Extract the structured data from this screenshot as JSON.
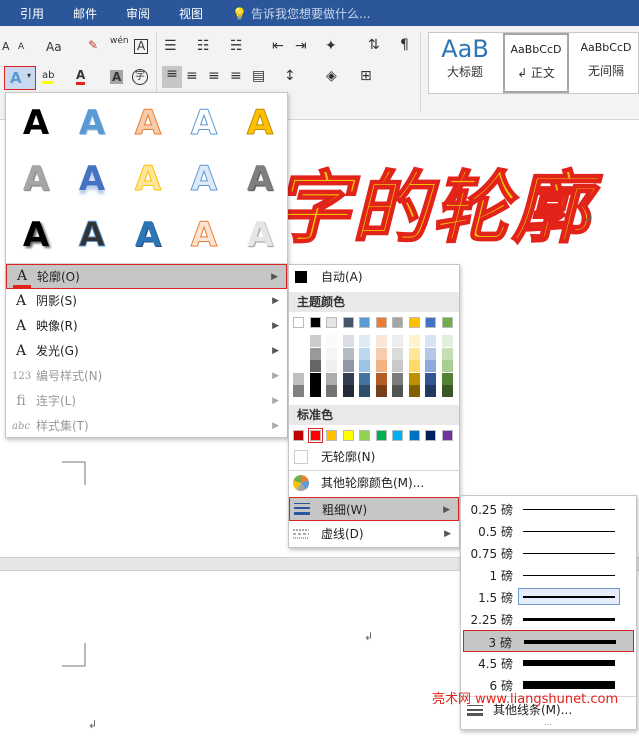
{
  "topbar": {
    "tabs": [
      "引用",
      "邮件",
      "审阅",
      "视图"
    ],
    "tell_me": "告诉我您想要做什么..."
  },
  "ribbon": {
    "font_size_up": "A",
    "font_size_down": "A",
    "change_case": "Aa",
    "phonetic_guide": "wén",
    "char_border": "A",
    "text_effects": "A",
    "highlight": "ab",
    "font_color": "A",
    "char_shading": "A",
    "enclose_char": "字",
    "styles": [
      {
        "sample": "AaB",
        "label": "大标题"
      },
      {
        "sample": "AaBbCcD",
        "label": "↲ 正文"
      },
      {
        "sample": "AaBbCcD",
        "label": "无间隔"
      }
    ]
  },
  "document": {
    "big_text": "字的轮廓",
    "pilcrow": "↲"
  },
  "fx_menu": {
    "letter": "A",
    "items": [
      {
        "icon": "A",
        "label": "轮廓(O)",
        "disabled": false
      },
      {
        "icon": "A",
        "label": "阴影(S)",
        "disabled": false
      },
      {
        "icon": "A",
        "label": "映像(R)",
        "disabled": false
      },
      {
        "icon": "A",
        "label": "发光(G)",
        "disabled": false
      },
      {
        "icon": "123",
        "label": "编号样式(N)",
        "disabled": true
      },
      {
        "icon": "fi",
        "label": "连字(L)",
        "disabled": true
      },
      {
        "icon": "abc",
        "label": "样式集(T)",
        "disabled": true
      }
    ]
  },
  "outline_menu": {
    "auto": "自动(A)",
    "theme_colors_header": "主题颜色",
    "standard_colors_header": "标准色",
    "no_outline": "无轮廓(N)",
    "more_colors": "其他轮廓颜色(M)...",
    "weight": "粗细(W)",
    "dashes": "虚线(D)",
    "theme_colors": [
      "#ffffff",
      "#000000",
      "#e7e6e6",
      "#44546a",
      "#5b9bd5",
      "#ed7d31",
      "#a5a5a5",
      "#ffc000",
      "#4472c4",
      "#70ad47"
    ],
    "standard_colors": [
      "#c00000",
      "#ff0000",
      "#ffc000",
      "#ffff00",
      "#92d050",
      "#00b050",
      "#00b0f0",
      "#0070c0",
      "#002060",
      "#7030a0"
    ]
  },
  "weight_menu": {
    "items": [
      {
        "label": "0.25 磅",
        "weight": 0.25
      },
      {
        "label": "0.5 磅",
        "weight": 0.5
      },
      {
        "label": "0.75 磅",
        "weight": 0.75
      },
      {
        "label": "1 磅",
        "weight": 1
      },
      {
        "label": "1.5 磅",
        "weight": 1.5
      },
      {
        "label": "2.25 磅",
        "weight": 2.25
      },
      {
        "label": "3 磅",
        "weight": 3
      },
      {
        "label": "4.5 磅",
        "weight": 4.5
      },
      {
        "label": "6 磅",
        "weight": 6
      }
    ],
    "more_lines": "其他线条(M)...",
    "current_index": 4,
    "selected_index": 6
  },
  "watermark": "亮术网 www.liangshunet.com"
}
